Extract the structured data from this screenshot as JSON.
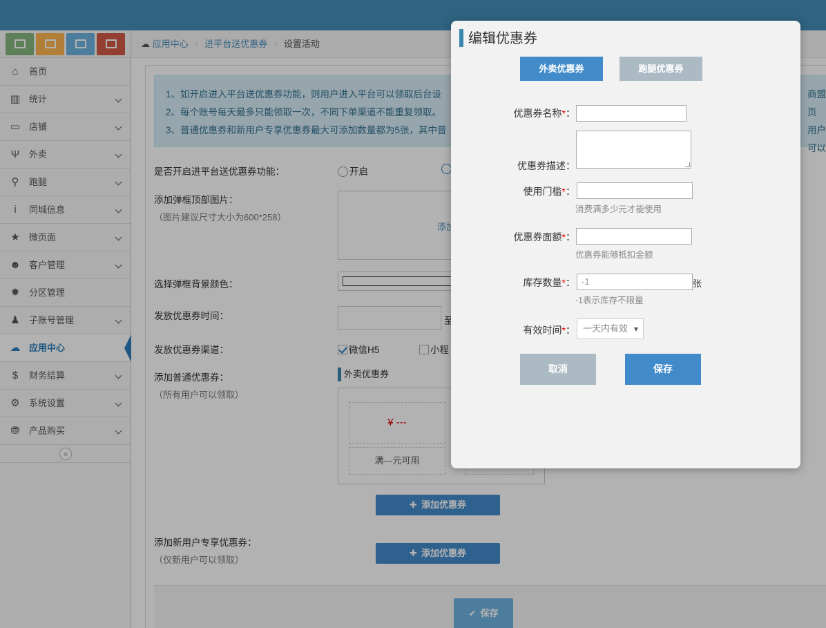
{
  "sidebar": {
    "shortcut_colors": [
      "#87b87f",
      "#ffb752",
      "#6fb3e0",
      "#d15b47"
    ],
    "shortcut_icons": [
      "chart-icon",
      "monitor-icon",
      "fork-knife-icon",
      "bag-icon"
    ],
    "items": [
      {
        "label": "首页",
        "icon": "⌂",
        "name": "home"
      },
      {
        "label": "统计",
        "icon": "▥",
        "name": "stats"
      },
      {
        "label": "店铺",
        "icon": "▭",
        "name": "shop"
      },
      {
        "label": "外卖",
        "icon": "Ψ",
        "name": "takeout"
      },
      {
        "label": "跑腿",
        "icon": "⚲",
        "name": "errand"
      },
      {
        "label": "同城信息",
        "icon": "i",
        "name": "local-info"
      },
      {
        "label": "微页面",
        "icon": "★",
        "name": "micro-page"
      },
      {
        "label": "客户管理",
        "icon": "☻",
        "name": "customers"
      },
      {
        "label": "分区管理",
        "icon": "✹",
        "name": "zones"
      },
      {
        "label": "子账号管理",
        "icon": "♟",
        "name": "sub-accounts"
      },
      {
        "label": "应用中心",
        "icon": "☁",
        "name": "app-center"
      },
      {
        "label": "财务结算",
        "icon": "$",
        "name": "finance"
      },
      {
        "label": "系统设置",
        "icon": "⚙",
        "name": "settings"
      },
      {
        "label": "产品购买",
        "icon": "⛃",
        "name": "purchase"
      }
    ],
    "collapse_glyph": "«"
  },
  "breadcrumb": {
    "item1": "应用中心",
    "item2": "进平台送优惠券",
    "item3": "设置活动",
    "sep": "›"
  },
  "notice": {
    "line1": "1、如开启进入平台送优惠券功能，则用户进入平台可以领取后台设",
    "line1_tail": "商盟页",
    "line2": "2、每个账号每天最多只能领取一次，不同下单渠道不能重复领取。",
    "line3": "3、普通优惠券和新用户专享优惠券最大可添加数量都为5张，其中普",
    "line3_tail": "用户可以"
  },
  "form": {
    "enable_label": "是否开启进平台送优惠券功能：",
    "enable_on": "开启",
    "popup_image_label": "添加弹框顶部图片：",
    "popup_image_hint": "（图片建议尺寸大小为600*258）",
    "popup_image_add": "添加",
    "bg_color_label": "选择弹框背景颜色：",
    "time_label": "发放优惠券时间：",
    "time_to": "至",
    "channel_label": "发放优惠券渠道：",
    "channel_wechat": "微信H5",
    "channel_mini": "小程",
    "normal_coupon_label": "添加普通优惠券：",
    "normal_coupon_hint": "（所有用户可以领取）",
    "coupon_tab": "外卖优惠券",
    "coupon_price": "¥ ---",
    "coupon_cond": "满---元可用",
    "add_coupon": "添加优惠券",
    "new_user_label": "添加新用户专享优惠券：",
    "new_user_hint": "（仅新用户可以领取）",
    "save": "保存"
  },
  "modal": {
    "title": "编辑优惠券",
    "tab_takeout": "外卖优惠券",
    "tab_errand": "跑腿优惠券",
    "name_label": "优惠券名称",
    "desc_label": "优惠券描述：",
    "threshold_label": "使用门槛",
    "threshold_hint": "消费满多少元才能使用",
    "amount_label": "优惠券面额",
    "amount_hint": "优惠券能够抵扣金额",
    "stock_label": "库存数量",
    "stock_value": "-1",
    "stock_unit": "张",
    "stock_hint": "-1表示库存不限量",
    "valid_label": "有效时间",
    "valid_value": "一天内有效",
    "required": "*",
    "colon": "：",
    "cancel": "取消",
    "save": "保存"
  },
  "colors": {
    "topbar": "#438eb9",
    "primary": "#428bca",
    "muted_button": "#a9b8c4",
    "required": "#ee0000"
  }
}
